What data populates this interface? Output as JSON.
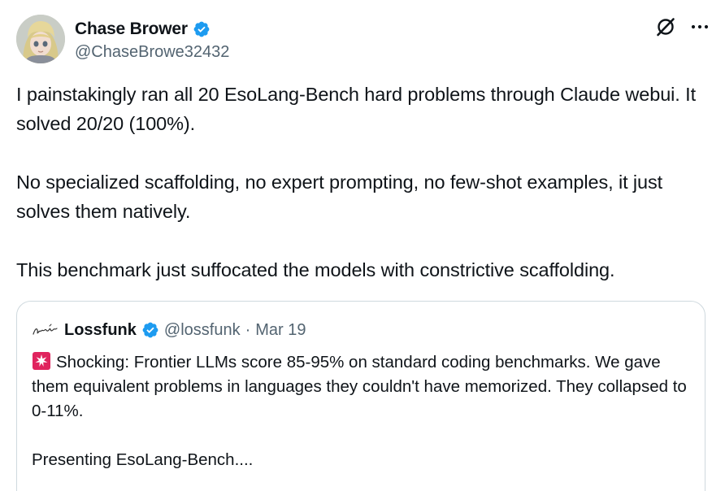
{
  "author": {
    "display_name": "Chase Brower",
    "handle": "@ChaseBrowe32432",
    "verified": true,
    "avatar_icon": "anime-avatar"
  },
  "actions": {
    "grok_icon": "grok-slash-icon",
    "more_icon": "more-options-icon"
  },
  "tweet": {
    "paragraphs": [
      "I painstakingly ran all 20 EsoLang-Bench hard problems through Claude webui. It solved 20/20 (100%).",
      "No specialized scaffolding, no expert prompting, no few-shot examples, it just solves them natively.",
      "This benchmark just suffocated the models with constrictive scaffolding."
    ]
  },
  "quote": {
    "display_name": "Lossfunk",
    "handle": "@lossfunk",
    "separator": "·",
    "date": "Mar 19",
    "verified": true,
    "logo_icon": "lossfunk-signature-logo",
    "emoji_icon": "rotating-light-icon",
    "paragraphs": [
      "Shocking: Frontier LLMs score 85-95% on standard coding benchmarks. We gave them equivalent problems in languages they couldn't have memorized. They collapsed to 0-11%.",
      "Presenting EsoLang-Bench...."
    ]
  },
  "colors": {
    "text": "#0f1419",
    "secondary": "#536471",
    "verified_blue": "#1d9bf0",
    "border": "#cfd9de",
    "siren_red": "#e0245e"
  }
}
